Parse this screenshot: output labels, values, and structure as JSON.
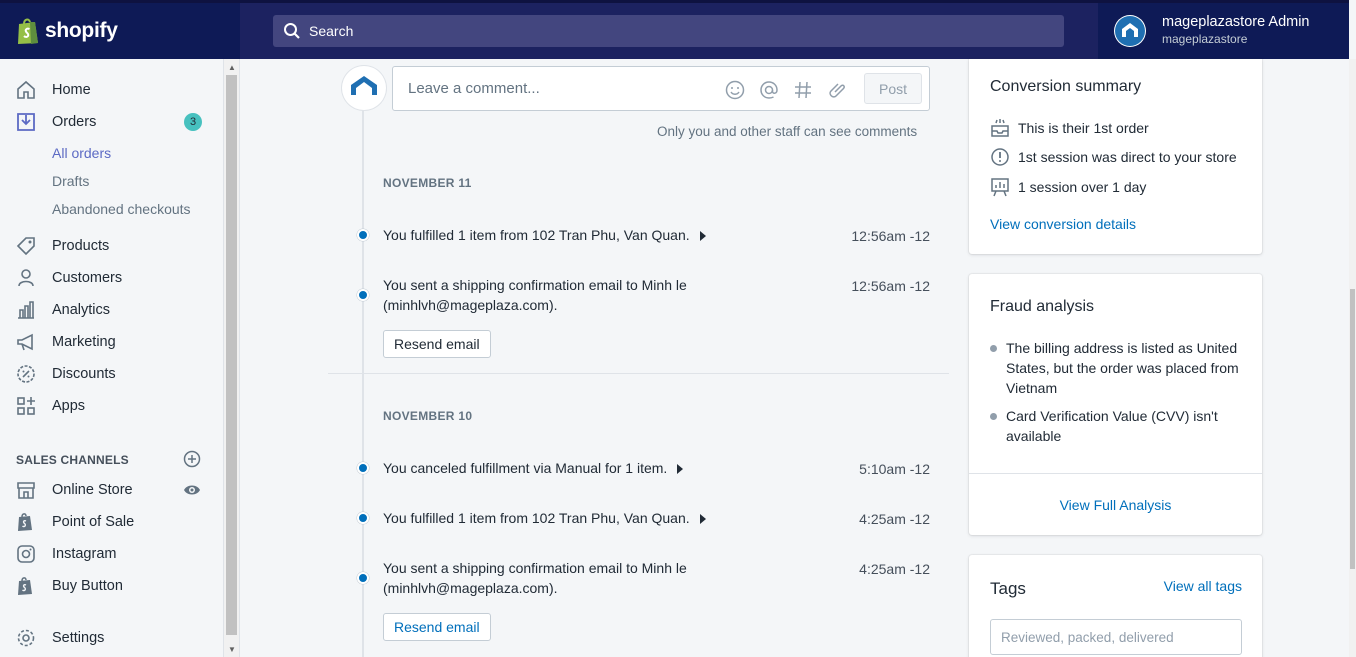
{
  "brand": {
    "name": "shopify"
  },
  "search": {
    "placeholder": "Search"
  },
  "account": {
    "name": "mageplazastore Admin",
    "store": "mageplazastore"
  },
  "sidebar": {
    "items": [
      {
        "label": "Home",
        "icon": "home-icon"
      },
      {
        "label": "Orders",
        "icon": "orders-icon",
        "badge": "3"
      },
      {
        "label": "Products",
        "icon": "tag-icon"
      },
      {
        "label": "Customers",
        "icon": "person-icon"
      },
      {
        "label": "Analytics",
        "icon": "bar-chart-icon"
      },
      {
        "label": "Marketing",
        "icon": "megaphone-icon"
      },
      {
        "label": "Discounts",
        "icon": "discount-icon"
      },
      {
        "label": "Apps",
        "icon": "apps-icon"
      }
    ],
    "orders_sub": [
      "All orders",
      "Drafts",
      "Abandoned checkouts"
    ],
    "sales_channels_title": "SALES CHANNELS",
    "channels": [
      {
        "label": "Online Store",
        "icon": "store-icon"
      },
      {
        "label": "Point of Sale",
        "icon": "shopify-bag-icon"
      },
      {
        "label": "Instagram",
        "icon": "instagram-icon"
      },
      {
        "label": "Buy Button",
        "icon": "shopify-bag-icon"
      }
    ],
    "settings": "Settings"
  },
  "comment": {
    "placeholder": "Leave a comment...",
    "post_label": "Post",
    "note": "Only you and other staff can see comments"
  },
  "timeline": {
    "groups": [
      {
        "date": "NOVEMBER 11",
        "events": [
          {
            "text": "You fulfilled 1 item from 102 Tran Phu, Van Quan.",
            "time": "12:56am -12"
          },
          {
            "text": "You sent a shipping confirmation email to Minh le (minhlvh@mageplaza.com).",
            "time": "12:56am -12",
            "button": "Resend email"
          }
        ]
      },
      {
        "date": "NOVEMBER 10",
        "events": [
          {
            "text": "You canceled fulfillment via Manual for 1 item.",
            "time": "5:10am -12"
          },
          {
            "text": "You fulfilled 1 item from 102 Tran Phu, Van Quan.",
            "time": "4:25am -12"
          },
          {
            "text": "You sent a shipping confirmation email to Minh le (minhlvh@mageplaza.com).",
            "time": "4:25am -12",
            "button": "Resend email"
          }
        ]
      }
    ]
  },
  "conversion": {
    "title": "Conversion summary",
    "rows": [
      "This is their 1st order",
      "1st session was direct to your store",
      "1 session over 1 day"
    ],
    "link": "View conversion details"
  },
  "fraud": {
    "title": "Fraud analysis",
    "items": [
      "The billing address is listed as United States, but the order was placed from Vietnam",
      "Card Verification Value (CVV) isn't available"
    ],
    "link": "View Full Analysis"
  },
  "tags": {
    "title": "Tags",
    "link": "View all tags",
    "placeholder": "Reviewed, packed, delivered"
  },
  "colors": {
    "topbar": "#1c2260",
    "accent": "#5c6ac4",
    "link": "#006fbb",
    "timeline_dot": "#006fbb",
    "badge": "#47c1bf"
  }
}
